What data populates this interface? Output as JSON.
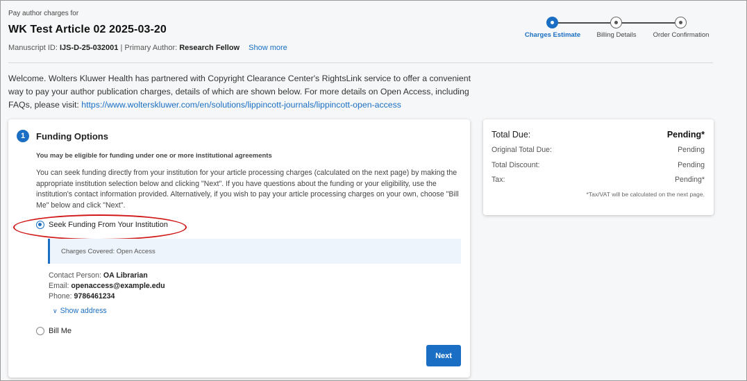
{
  "header": {
    "subtitle": "Pay author charges for",
    "title": "WK Test Article 02 2025-03-20",
    "manuscript_label": "Manuscript ID:",
    "manuscript_id": "IJS-D-25-032001",
    "separator": "|",
    "author_label": "Primary Author:",
    "author": "Research Fellow",
    "show_more": "Show more"
  },
  "stepper": {
    "steps": [
      {
        "label": "Charges Estimate",
        "active": true
      },
      {
        "label": "Billing Details",
        "active": false
      },
      {
        "label": "Order Confirmation",
        "active": false
      }
    ]
  },
  "welcome": {
    "text": "Welcome. Wolters Kluwer Health has partnered with Copyright Clearance Center's RightsLink service to offer a convenient way to pay your author publication charges, details of which are shown below. For more details on Open Access, including FAQs, please visit: ",
    "url": "https://www.wolterskluwer.com/en/solutions/lippincott-journals/lippincott-open-access"
  },
  "funding": {
    "number": "1",
    "title": "Funding Options",
    "subtitle": "You may be eligible for funding under one or more institutional agreements",
    "description": "You can seek funding directly from your institution for your article processing charges (calculated on the next page) by making the appropriate institution selection below and clicking \"Next\". If you have questions about the funding or your eligibility, use the institution's contact information provided. Alternatively, if you wish to pay your article processing charges on your own, choose \"Bill Me\" below and click \"Next\".",
    "option_institution": "Seek Funding From Your Institution",
    "option_bill_me": "Bill Me",
    "charges_covered": "Charges Covered: Open Access",
    "contact_person_label": "Contact Person:",
    "contact_person": "OA Librarian",
    "email_label": "Email:",
    "email": "openaccess@example.edu",
    "phone_label": "Phone:",
    "phone": "9786461234",
    "show_address": "Show address",
    "next_button": "Next"
  },
  "summary": {
    "total_due_label": "Total Due:",
    "total_due": "Pending*",
    "original_label": "Original Total Due:",
    "original": "Pending",
    "discount_label": "Total Discount:",
    "discount": "Pending",
    "tax_label": "Tax:",
    "tax": "Pending*",
    "note": "*Tax/VAT will be calculated on the next page."
  },
  "colors": {
    "accent": "#1a6fc4",
    "highlight_oval": "#d11919"
  }
}
